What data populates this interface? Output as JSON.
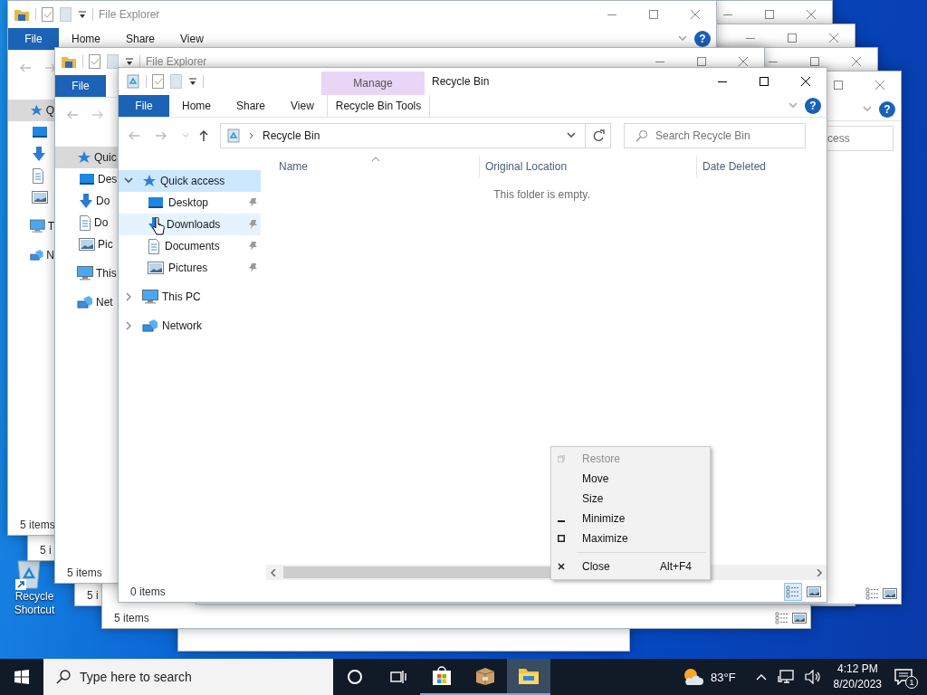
{
  "desktop": {
    "icons": [
      {
        "kind": "recycle",
        "label": "Recycle Shortcut"
      }
    ]
  },
  "background_windows": [
    {
      "kind": "explorer",
      "status": "5 i"
    },
    {
      "kind": "explorer",
      "status": "5 i"
    },
    {
      "kind": "explorer"
    },
    {
      "kind": "plain"
    },
    {
      "kind": "explorer",
      "status": "5 items",
      "view_icons": true
    },
    {
      "kind": "explorer",
      "help": "?",
      "search_placeholder": "cess",
      "view_icons": true
    },
    {
      "kind": "explorer",
      "title": "File Explorer",
      "ribbon_tabs": [
        {
          "kind": "file",
          "label": "File"
        },
        {
          "kind": "tab",
          "label": "Home"
        },
        {
          "kind": "tab",
          "label": "Share"
        },
        {
          "kind": "tab",
          "label": "View"
        }
      ],
      "help": "?",
      "nav_arrows": true,
      "status": "5 items",
      "nav_items": [
        {
          "kind": "star",
          "label": "Q",
          "selected": true,
          "children": [
            {
              "kind": "desktop",
              "selected": false
            },
            {
              "kind": "download",
              "selected": false
            },
            {
              "kind": "document",
              "selected": false
            },
            {
              "kind": "picture",
              "selected": false
            }
          ]
        },
        {
          "kind": "computer",
          "label": "T",
          "selected": false
        },
        {
          "kind": "network",
          "label": "N",
          "selected": false
        }
      ]
    },
    {
      "kind": "explorer",
      "title": "File Explorer",
      "ribbon_tabs": [
        {
          "kind": "file",
          "label": "File"
        }
      ],
      "nav_arrows": true,
      "status": "5 items",
      "nav_items": [
        {
          "kind": "star",
          "label": "Quic",
          "selected": true,
          "children": [
            {
              "kind": "desktop",
              "label": "Des",
              "selected": false
            },
            {
              "kind": "download",
              "label": "Do",
              "selected": false
            },
            {
              "kind": "document",
              "label": "Do",
              "selected": false
            },
            {
              "kind": "picture",
              "label": "Pic",
              "selected": false
            }
          ]
        },
        {
          "kind": "computer",
          "label": "This",
          "selected": false
        },
        {
          "kind": "network",
          "label": "Net",
          "selected": false
        }
      ]
    }
  ],
  "window": {
    "title": "Recycle Bin",
    "context_tab": "Manage",
    "help": "?",
    "ribbon_tabs": [
      {
        "kind": "file",
        "label": "File"
      },
      {
        "kind": "tab",
        "label": "Home"
      },
      {
        "kind": "tab",
        "label": "Share"
      },
      {
        "kind": "tab",
        "label": "View"
      },
      {
        "kind": "context",
        "label": "Recycle Bin Tools"
      }
    ],
    "address": {
      "path": "Recycle Bin"
    },
    "search": {
      "placeholder": "Search Recycle Bin"
    },
    "nav_items": [
      {
        "kind": "star",
        "label": "Quick access",
        "expanded": true,
        "selected": true,
        "hovered": false,
        "children": [
          {
            "kind": "desktop",
            "label": "Desktop",
            "pinned": true,
            "selected": false,
            "hovered": false
          },
          {
            "kind": "download",
            "label": "Downloads",
            "pinned": true,
            "selected": false,
            "hovered": true
          },
          {
            "kind": "document",
            "label": "Documents",
            "pinned": true,
            "selected": false,
            "hovered": false
          },
          {
            "kind": "picture",
            "label": "Pictures",
            "pinned": true,
            "selected": false,
            "hovered": false
          }
        ]
      },
      {
        "kind": "computer",
        "label": "This PC",
        "expanded": false,
        "selected": false,
        "hovered": false
      },
      {
        "kind": "network",
        "label": "Network",
        "expanded": false,
        "selected": false,
        "hovered": false
      }
    ],
    "columns": [
      {
        "label": "Name",
        "sorted": true
      },
      {
        "label": "Original Location",
        "sorted": false
      },
      {
        "label": "Date Deleted",
        "sorted": false
      }
    ],
    "empty_message": "This folder is empty.",
    "status": "0 items",
    "view_buttons": [
      {
        "kind": "details",
        "selected": true
      },
      {
        "kind": "large_icons",
        "selected": false
      }
    ]
  },
  "context_menu": {
    "items": [
      {
        "kind": "restore",
        "label": "Restore",
        "disabled": true
      },
      {
        "kind": "move",
        "label": "Move",
        "disabled": false
      },
      {
        "kind": "size",
        "label": "Size",
        "disabled": false
      },
      {
        "kind": "minimize",
        "label": "Minimize",
        "disabled": false
      },
      {
        "kind": "maximize",
        "label": "Maximize",
        "disabled": false
      },
      {
        "kind": "separator"
      },
      {
        "kind": "close",
        "label": "Close",
        "shortcut": "Alt+F4",
        "disabled": false
      }
    ]
  },
  "taskbar": {
    "search_placeholder": "Type here to search",
    "apps": [
      {
        "kind": "cortana",
        "running": false,
        "active": false
      },
      {
        "kind": "task_view",
        "running": false,
        "active": false
      },
      {
        "kind": "store",
        "running": true,
        "active": false
      },
      {
        "kind": "package",
        "running": true,
        "active": false
      },
      {
        "kind": "explorer",
        "running": true,
        "active": true
      }
    ],
    "weather": "83°F",
    "time": "4:12 PM",
    "date": "8/20/2023",
    "notifications": "1"
  }
}
